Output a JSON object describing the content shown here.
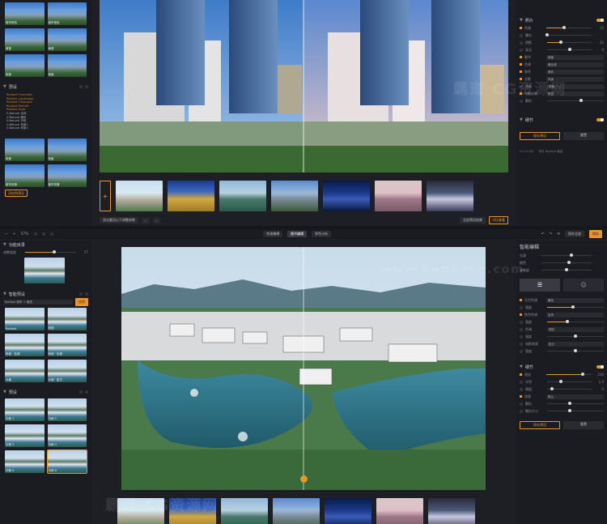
{
  "window1": {
    "left_presets": [
      "城市夜色",
      "城市夜色",
      "黄昏",
      "黄昏",
      "街景",
      "街景"
    ],
    "section_presets": "预设",
    "preset_list": [
      "Radiant Cinematic",
      "Radiant Landscape",
      "Radiant Cityscape",
      "Radiant Portrait",
      "Radiant Food",
      "V-Natural 自然",
      "V-Natural 暖色",
      "V-Natural 冷色",
      "V-Natural 风景1",
      "V-Natural 风景2"
    ],
    "lower_presets": [
      "街景",
      "街景",
      "都市风情",
      "都市风情"
    ],
    "add_preset_button": "添加到预设",
    "right": {
      "section_light": "照片",
      "rows": [
        {
          "name": "色调",
          "val": "13"
        },
        {
          "name": "曝光",
          "val": ""
        },
        {
          "name": "阴影",
          "val": "32"
        },
        {
          "name": "高光",
          "val": "0"
        }
      ],
      "select_rows": [
        {
          "name": "细节",
          "sel": "精细"
        },
        {
          "name": "色调",
          "sel": "暖色调"
        },
        {
          "name": "肤色",
          "sel": "柔和"
        },
        {
          "name": "光影",
          "sel": "风景"
        },
        {
          "name": "强度",
          "sel": "鲜艳"
        },
        {
          "name": "电影效果",
          "sel": "黑白"
        },
        {
          "name": "颗粒",
          "sel": ""
        }
      ],
      "section_detail": "细节",
      "save_button": "保存预设",
      "apply_button": "重置",
      "version": "v1.13.352",
      "brand": "软件 Radiant 套装"
    },
    "bottom": {
      "hint": "双击重设以下调整参数",
      "right_btn": "全部预设效果",
      "compare_btn": "对比查看"
    }
  },
  "window2": {
    "zoom": "57%",
    "tabs": [
      "快速编辑",
      "细节编辑",
      "原色分析"
    ],
    "export_button": "保存全部",
    "share_button": "保存",
    "left": {
      "section_func": "功能目录",
      "strength_label": "调整强度",
      "strength_val": "57",
      "section_smart": "智能预设",
      "smart_select": "Radiant 城市 + 晚霞",
      "apply_btn": "应用",
      "smart_presets": [
        "Radiant",
        "家园",
        "粉城 · 色调",
        "粉城 · 色调",
        "大城",
        "大城 · 复古"
      ],
      "section_presets": "预设",
      "presets": [
        "平和 1",
        "平和 2",
        "平和 3",
        "平和 4",
        "平和 5",
        "平和 6"
      ]
    },
    "right": {
      "section_title": "智能编辑",
      "rows": [
        {
          "name": "光源",
          "val": ""
        },
        {
          "name": "颜色",
          "val": ""
        },
        {
          "name": "清晰度",
          "val": ""
        }
      ],
      "select_rows": [
        {
          "name": "天空色调",
          "sel": "暖色"
        },
        {
          "name": "强度",
          "sel": ""
        },
        {
          "name": "肤色色调",
          "sel": "自然"
        },
        {
          "name": "强度",
          "sel": ""
        },
        {
          "name": "色调",
          "sel": "明亮"
        },
        {
          "name": "强度",
          "sel": ""
        },
        {
          "name": "电影效果",
          "sel": "复古"
        },
        {
          "name": "强度",
          "sel": ""
        }
      ],
      "section_detail": "细节",
      "detail_rows": [
        {
          "name": "锐化",
          "val": "100"
        },
        {
          "name": "半径",
          "val": "1.0"
        },
        {
          "name": "阈值",
          "val": "0"
        },
        {
          "name": "纹理",
          "sel": "默认"
        },
        {
          "name": "颗粒",
          "val": ""
        },
        {
          "name": "颗粒大小",
          "val": ""
        }
      ],
      "save_button": "保存预设",
      "reset_button": "重置"
    }
  },
  "watermark": "霸道 CG资源网",
  "watermark_url": "www.badaocg.com"
}
